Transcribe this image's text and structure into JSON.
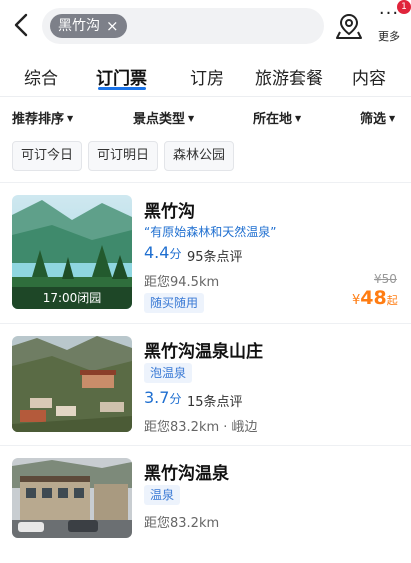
{
  "header": {
    "chip_text": "黑竹沟",
    "chip_close": "×",
    "more_dots": "···",
    "more_label": "更多",
    "badge_count": "1"
  },
  "tabs": [
    {
      "label": "综合",
      "active": false
    },
    {
      "label": "订门票",
      "active": true
    },
    {
      "label": "订房",
      "active": false
    },
    {
      "label": "旅游套餐",
      "active": false
    },
    {
      "label": "内容",
      "active": false
    }
  ],
  "filters": [
    {
      "label": "推荐排序"
    },
    {
      "label": "景点类型"
    },
    {
      "label": "所在地"
    },
    {
      "label": "筛选"
    }
  ],
  "quick_filters": [
    "可订今日",
    "可订明日",
    "森林公园"
  ],
  "results": [
    {
      "title": "黑竹沟",
      "slogan": "“有原始森林和天然温泉”",
      "score": "4.4",
      "score_unit": "分",
      "reviews": "95条点评",
      "distance": "距您94.5km",
      "tag": "随买随用",
      "close_time": "17:00闭园",
      "original_price": "¥50",
      "price_currency": "¥",
      "price": "48",
      "price_suffix": "起"
    },
    {
      "title": "黑竹沟温泉山庄",
      "tag": "泡温泉",
      "score": "3.7",
      "score_unit": "分",
      "reviews": "15条点评",
      "distance": "距您83.2km · 峨边"
    },
    {
      "title": "黑竹沟温泉",
      "tag": "温泉",
      "distance": "距您83.2km"
    }
  ],
  "colors": {
    "accent": "#1a73e8",
    "score_blue": "#1f6fd0",
    "price_orange": "#ff7d13",
    "badge_red": "#e0243b"
  }
}
